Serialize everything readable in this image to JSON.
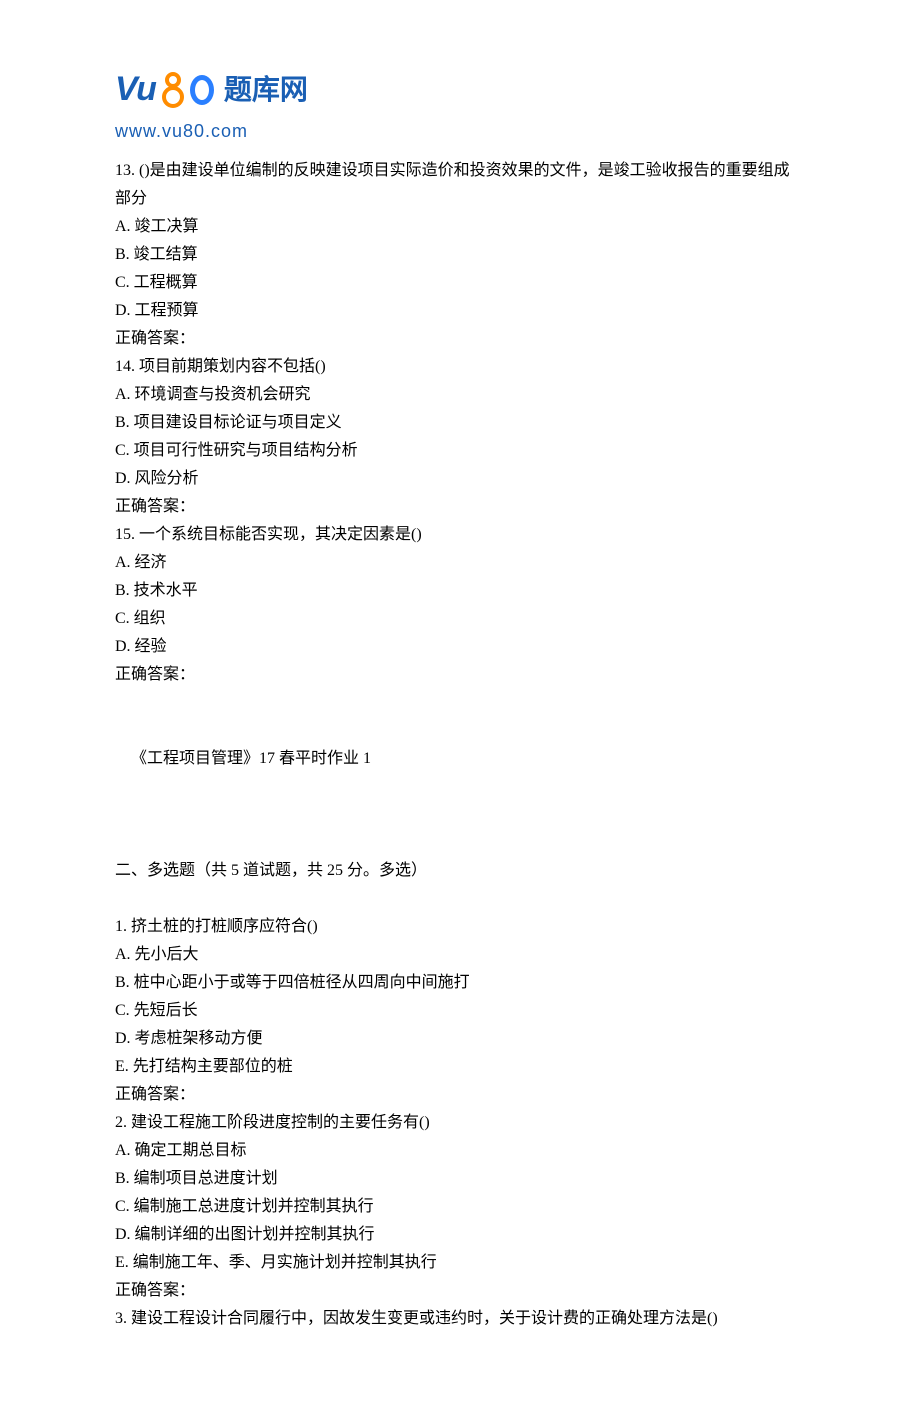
{
  "logo": {
    "brand_text": "题库网",
    "url": "www.vu80.com"
  },
  "q13": {
    "stem": "13.   ()是由建设单位编制的反映建设项目实际造价和投资效果的文件，是竣工验收报告的重要组成部分",
    "optA": "A.  竣工决算",
    "optB": "B.  竣工结算",
    "optC": "C.  工程概算",
    "optD": "D.  工程预算",
    "answer": "正确答案："
  },
  "q14": {
    "stem": "14.    项目前期策划内容不包括()",
    "optA": "A.  环境调查与投资机会研究",
    "optB": "B.  项目建设目标论证与项目定义",
    "optC": "C.  项目可行性研究与项目结构分析",
    "optD": "D.  风险分析",
    "answer": "正确答案："
  },
  "q15": {
    "stem": "15.    一个系统目标能否实现，其决定因素是()",
    "optA": "A.  经济",
    "optB": "B.  技术水平",
    "optC": "C.  组织",
    "optD": "D.  经验",
    "answer": "正确答案："
  },
  "section2": {
    "title": "《工程项目管理》17 春平时作业 1",
    "header": "二、多选题（共  5  道试题，共  25  分。多选）"
  },
  "mq1": {
    "stem": "1.    挤土桩的打桩顺序应符合()",
    "optA": "A.  先小后大",
    "optB": "B.  桩中心距小于或等于四倍桩径从四周向中间施打",
    "optC": "C.  先短后长",
    "optD": "D.  考虑桩架移动方便",
    "optE": "E.  先打结构主要部位的桩",
    "answer": "正确答案："
  },
  "mq2": {
    "stem": "2.    建设工程施工阶段进度控制的主要任务有()",
    "optA": "A.  确定工期总目标",
    "optB": "B.  编制项目总进度计划",
    "optC": "C.  编制施工总进度计划并控制其执行",
    "optD": "D.  编制详细的出图计划并控制其执行",
    "optE": "E.  编制施工年、季、月实施计划并控制其执行",
    "answer": "正确答案："
  },
  "mq3": {
    "stem": "3.    建设工程设计合同履行中，因故发生变更或违约时，关于设计费的正确处理方法是()"
  }
}
